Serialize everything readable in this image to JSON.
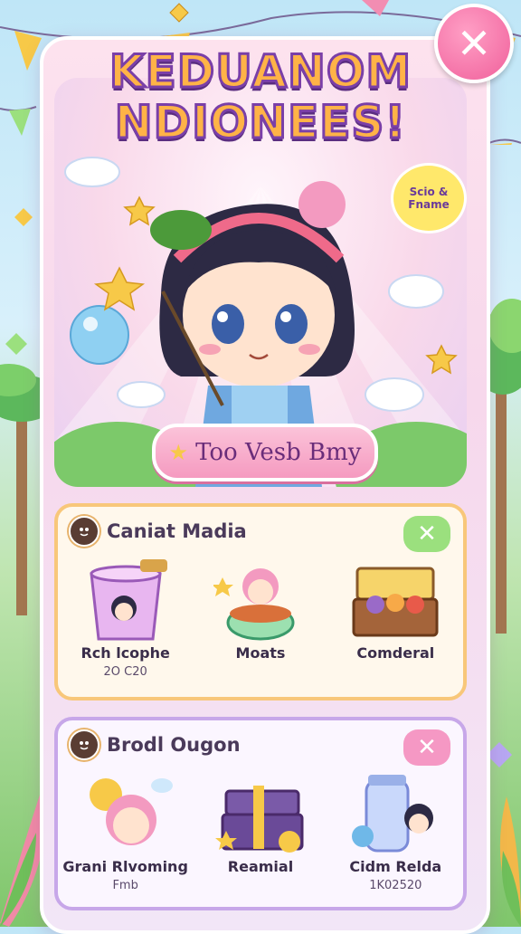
{
  "title": {
    "line1": "KEDUANOM",
    "line2": "NDIONEES!"
  },
  "close_button": {
    "label": "✕"
  },
  "speech_bubble": {
    "line1": "Scio &",
    "line2": "Fname"
  },
  "play_button": {
    "label": "Too Vesb Bmy",
    "icon": "star-icon"
  },
  "section1": {
    "title": "Caniat Madia",
    "close_label": "✕",
    "items": [
      {
        "name": "Rch lcophe",
        "sub": "2O C20"
      },
      {
        "name": "Moats",
        "sub": ""
      },
      {
        "name": "Comderal",
        "sub": ""
      }
    ]
  },
  "section2": {
    "title": "Brodl Ougon",
    "close_label": "✕",
    "items": [
      {
        "name": "Grani Rlvoming",
        "sub": "Fmb"
      },
      {
        "name": "Reamial",
        "sub": ""
      },
      {
        "name": "Cidm Relda",
        "sub": "1K02520"
      }
    ]
  },
  "colors": {
    "accent_pink": "#f0609b",
    "accent_green": "#9be07e",
    "card1_border": "#f8c77a",
    "card2_border": "#c7a7e9"
  }
}
